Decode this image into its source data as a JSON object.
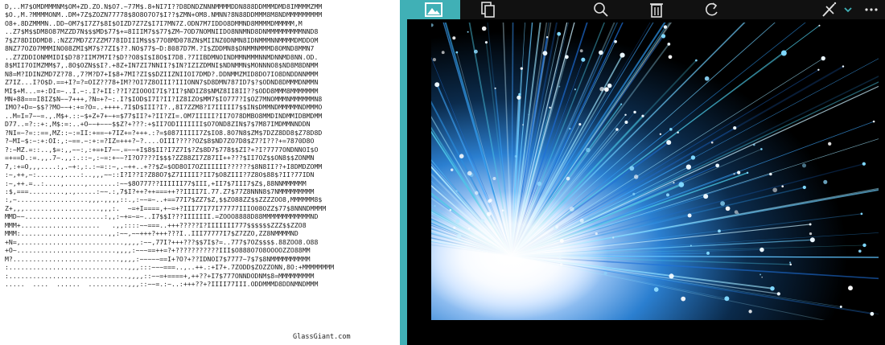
{
  "ascii_art": {
    "lines": [
      "D,..M7$OMDMMMNM$OM+ZD.ZO.N$O7.~77M$.8+NI7I??D8DNDZNNNMMMMDDN888DDMMMDMD8IMMMMZMM",
      "$O.,M.?MMMMONM..DM+7Z$ZOZN77778$8O8O7O7$I??$ZMN+OM8.NMNN?8N88DDMMM8M8NDMMMMMMMMM",
      "O8+.8DZMMMN..DD~OM7$I7Z7$8I$OIZD7Z7Z$I7I7MN7Z.ODN7M7IDDO8DMMND8MMMMDMMMMM,M",
      "..Z7$M$$DM8O87MZZD7N$$$MD$77$+=8IIIM7$$77$ZM~7OD7NOMNIIDO8NNMND8DNMMMMMMMMMNND8",
      "7$Z78DIDDMD8.:NZZ7MD7Z7ZZM778IDIIIM$$$77O8MD078ZN$MIINZ0DNMN8IDNMMMNNMMMMDMDDOM",
      "8NZ77OZ07MMMINO08ZMI$M7$?7ZI$??.NO$77$~D:8087D7M.?I$ZDDMN8$DNMMNMMMD8OMND8MMN7",
      "..Z7ZDDIONMMIDI$D?8?IIM7M7I?$D??O8$I$I8O$I7D8.?7IIBDMNOINDMMNMMMNNMDNNMD8NN.OD.",
      "8$MII7OIMZMM$7,.8O$OZN$$I?.+8Z+IN7ZI7NNII?$IN?IZIZDMNI$NDNMMN$MONNNO8$ND8M8DNMM",
      "N8=M?IDINZMD7Z?78.,7?M?D7+I$8+7MI?ZI$$DZIIZNIIOI7DMD?.DDNMMZMID8DO7IO8DNDDNNMMM",
      "Z7IZ...I?O$D.==+I?=?=OIZ??78+IM??OI7Z8OIII?IIIONN7$D8DMN787ID7$?$ODND8DMMMDNMMN",
      "MI$+M...=+:DI=~..I.~:.I?+II:??I?ZIOOOI7I$?II?$NDIZ8$NMZ8II8II??$ODD8MMM8MMMMMMM",
      "MN+88===I8IZ$N~~7+++,?N=+?~:.I?$IOD$I7I?II?IZ8IZO$MM7$IO777?I$OZ7MNOMMMNMMMMMMN8",
      "IMO?+D=~$$??MO~~+:+=?O=..++++.7I$D$III?I?.,8I7ZZM8?I7IIIII7$$IN$DMMNDMMMMMNDMMMO",
      "..M=I=7~~=.,.M$+.::~$+Z+7+~+=$77$II?+?II?ZI=.OM7IIIII?II7O78DMBO8MMDINDMMIDBMDMM",
      "D77..=?::+:,M$:=:..+O~~+~~~$$Z?+???:+$II7ODIIIIIII$O7OND8ZIN$7$7M87IMDMMNNDDN",
      "?NI=~?=::==,MZ::~:=II:+==~+7IZ+=?+++.:?=$087IIIII7Z$IO8.8O7N8$ZM$7DZZ8DD8$Z78D8D",
      "?~MI~$:~:+:OI:,:~==.~:+:=?IZ=+++?~?....OIII?????OZ$8$ND7ZO7D8$Z7?I???+=7870D8O",
      "?:~MZ.=::..,$=:,,~~:,:+=+I7~~.=~~+I$8$II?I7Z7I$?Z$8D7$778$$ZI?+?I?7777ONDNNOI$O",
      "=+==D.:=.,,.7~.,,:.::~,:~=:+~~?I?O7???I$$$?ZZ88ZI7Z87II++???$II7OZ$$ON8$$ZONMN",
      "7,:+=O,,,....:,.~+:,:.:~=::~,.~++..+??$Z=$OD8OI7OZIIIIII??????$8N8II??+I8DMDZOMM",
      ":~,++,~:......,....:..,,,~~::I?I??I?Z88O7$Z7IIIII?II7$O8ZIII?7Z8O$88$?II?77IDN",
      ":~,++.=..:....,.....,.......:~~$8O777??IIIIII77$III,+II7$7III7$Z$,88NNMMMMMM",
      ":$,===.........,.,.....:~~.:,7$I?++?++===++??IIII7I.77.Z7$77Z8NNN8$7NMMMMMMMMM",
      ":,~..................,,,.,,,,::.,:~~=~..+==77I7$ZZ7$Z,$$ZO88ZZ$$ZZZZOO8,MMMMMM8$",
      "Z+,,,...................,,,:.  ~=+I====,+~=+?III77I77I77777IIIO08OZZ$77$8NNNDMMMM",
      "MMD~~....................:,,:~+=~=~..I7$$I???IIIIIII.=ZOOO8888D88MMMMMMMMMMMMND",
      "MMM+....................   .,,::::~~===..+++?????I?IIIIIII777$$$$$$ZZZ$$ZZO8",
      "MMM:......................,,:~~,~~+++?+++???I..III77777I7$Z7ZZO,ZZ8NMMMMND",
      "+N=,..........................,,,,:~~,77I?+++???$$7I$?=..777$7OZ$$$$.88ZOO8.O88",
      "+O~.........................,,,,:~~~==++=?+???????????III$O888O7O8OOOOZZO88MM",
      "M?...........................,,,,:~~~~~==I+?O?+??IDNOI7$7777~7$7$8NMMMMMMMMMM",
      ":..............................,,,:::~~~===..,..++.:+I7+.7ZODD$ZOZZONN,8O:+MMMMMMMM",
      ":..............................,,,,::~~=+====+,++??+I7$777ONNDODNM$8=MMMMMMMMM",
      ".....  ....  ......  ..........,,,::~~=.:~..:+++??+?IIII77III.ODDMMMD8DDNMNDMMM"
    ],
    "credit": "GlassGiant.com"
  },
  "viewer": {
    "toolbar_icons": [
      "image-icon",
      "copy-icon",
      "zoom-icon",
      "delete-icon",
      "rotate-icon",
      "edit-icon",
      "chevron-down-icon",
      "more-icon"
    ],
    "accent_color": "#40b0b6",
    "photo_description_icon": "fiber-optic-photo"
  }
}
